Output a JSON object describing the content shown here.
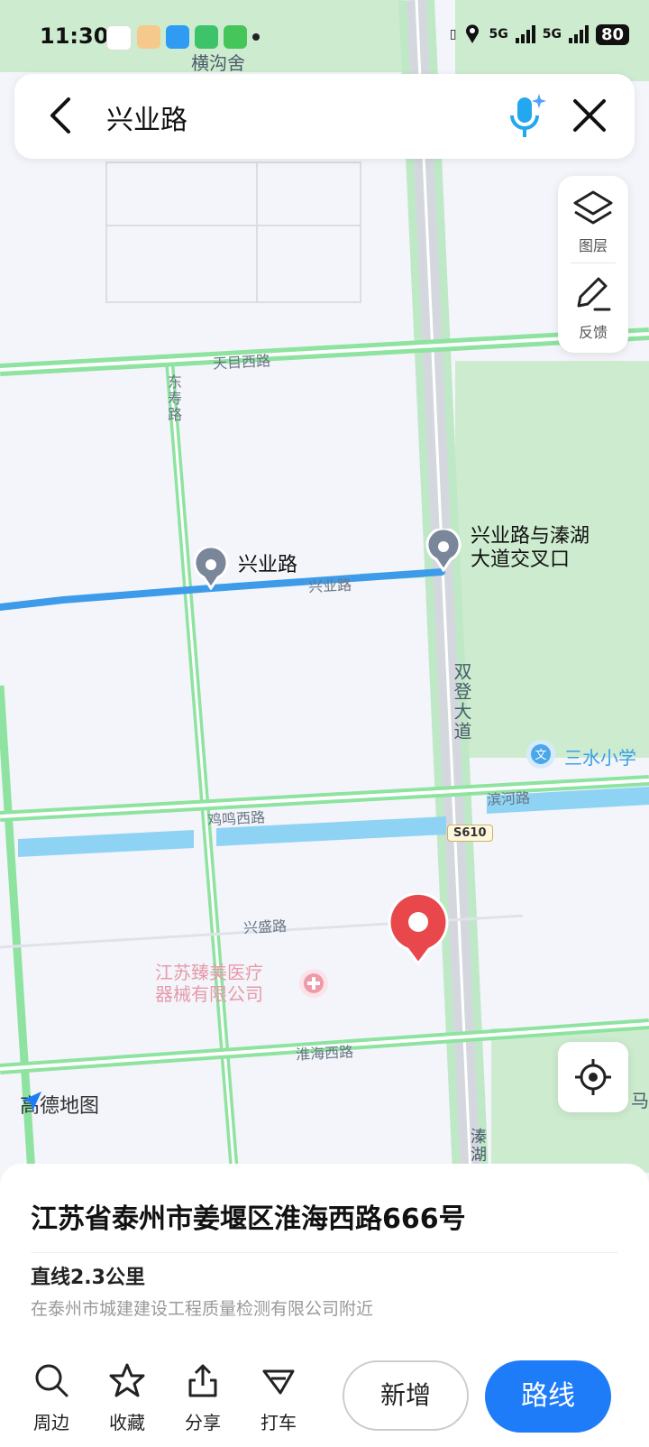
{
  "status_bar": {
    "time": "11:30",
    "network": "5G",
    "battery": "80"
  },
  "search": {
    "query": "兴业路"
  },
  "side_tools": {
    "layers_label": "图层",
    "feedback_label": "反馈"
  },
  "map": {
    "top_area_label": "横沟舍",
    "roads": {
      "tianmu": "天目西路",
      "dongshou": "东寿路",
      "xingye": "兴业路",
      "shuangdeng": "双登大道",
      "binhe": "滨河路",
      "jiming": "鸡鸣西路",
      "xingsheng": "兴盛路",
      "huaihai": "淮海西路",
      "qinhu": "溱湖"
    },
    "shield": "S610",
    "poi_xingye": "兴业路",
    "poi_intersection_line1": "兴业路与溱湖",
    "poi_intersection_line2": "大道交叉口",
    "poi_school": "三水小学",
    "poi_company_line1": "江苏臻美医疗",
    "poi_company_line2": "器械有限公司",
    "edge_label": "马",
    "watermark": "高德地图"
  },
  "sheet": {
    "address": "江苏省泰州市姜堰区淮海西路666号",
    "distance": "直线2.3公里",
    "nearby": "在泰州市城建建设工程质量检测有限公司附近"
  },
  "bottom_bar": {
    "nearby": "周边",
    "favorite": "收藏",
    "share": "分享",
    "taxi": "打车",
    "add": "新增",
    "route": "路线"
  },
  "colors": {
    "accent": "#1f7cf8",
    "road_green": "#8ee3a0",
    "route_blue": "#3d9be9",
    "pin_red": "#e8474b",
    "water": "#8fd3f4"
  }
}
